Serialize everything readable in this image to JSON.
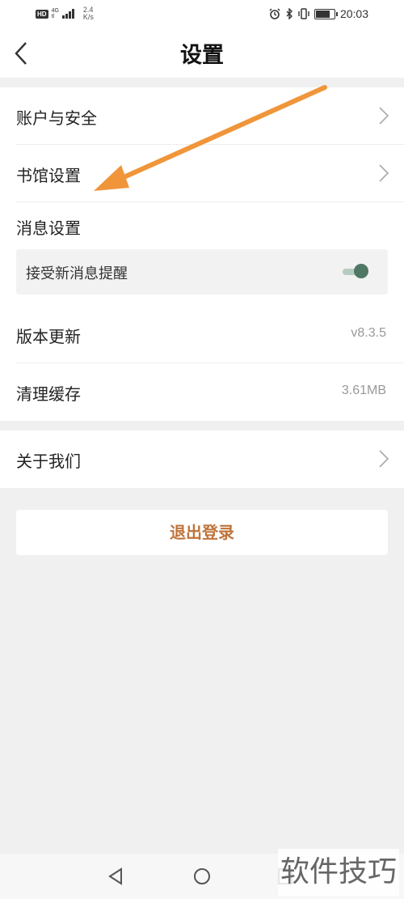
{
  "status_bar": {
    "hd": "HD",
    "network_top": "4G",
    "network_bottom": "tl",
    "speed_top": "2.4",
    "speed_bottom": "K/s",
    "time": "20:03",
    "battery_level": 0.85
  },
  "header": {
    "title": "设置",
    "back_icon": "chevron-left-icon"
  },
  "settings": {
    "group1": [
      {
        "label": "账户与安全",
        "icon": "chevron-right-icon"
      },
      {
        "label": "书馆设置",
        "icon": "chevron-right-icon"
      }
    ],
    "message_settings": {
      "label": "消息设置",
      "notify_label": "接受新消息提醒",
      "notify_enabled": true
    },
    "version": {
      "label": "版本更新",
      "value": "v8.3.5"
    },
    "cache": {
      "label": "清理缓存",
      "value": "3.61MB"
    },
    "about": {
      "label": "关于我们",
      "icon": "chevron-right-icon"
    }
  },
  "logout_label": "退出登录",
  "watermark": "软件技巧",
  "colors": {
    "accent": "#c0733a",
    "toggle_on": "#4f7864",
    "annotation_arrow": "#f0953a"
  }
}
